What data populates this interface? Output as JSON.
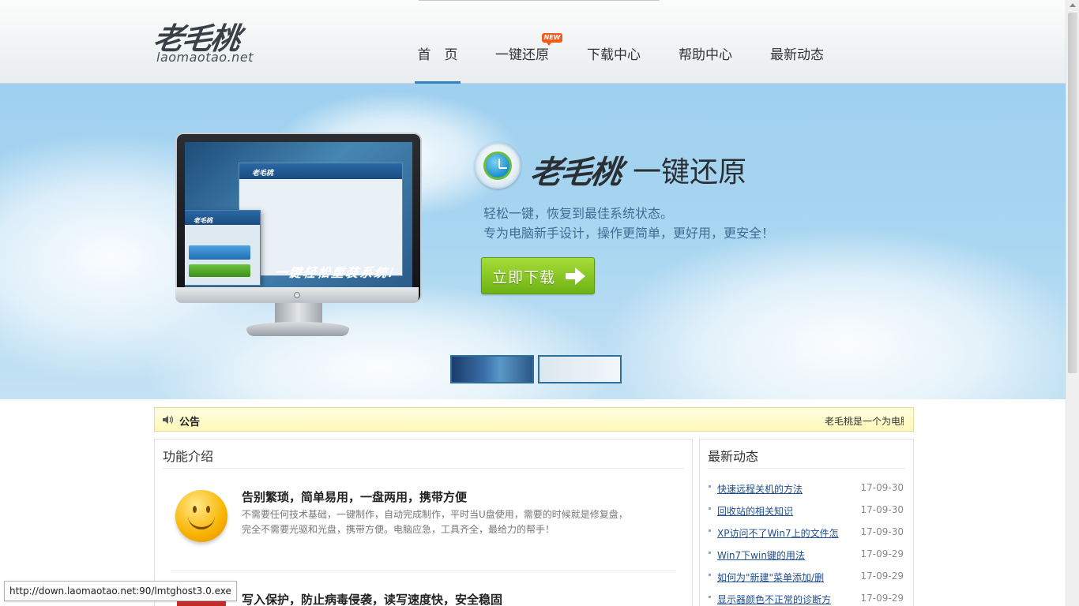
{
  "header": {
    "logo_cn": "老毛桃",
    "logo_en": "laomaotao.net",
    "nav": [
      {
        "label": "首　页"
      },
      {
        "label": "一键还原"
      },
      {
        "label": "下载中心"
      },
      {
        "label": "帮助中心"
      },
      {
        "label": "最新动态"
      }
    ],
    "new_badge": "NEW"
  },
  "banner": {
    "brand_logo": "老毛桃",
    "brand_sub": "一键还原",
    "tagline_1": "轻松一键，恢复到最佳系统状态。",
    "tagline_2": "专为电脑新手设计，操作更简单，更好用，更安全！",
    "download_label": "立即下载",
    "screen_slogan": "一键轻松重装系统!",
    "screen_logo": "老毛桃"
  },
  "notice": {
    "title": "公告",
    "text": "老毛桃是一个为电脑"
  },
  "features": {
    "title": "功能介绍",
    "items": [
      {
        "title": "告别繁琐，简单易用，一盘两用，携带方便",
        "desc": "不需要任何技术基础，一键制作，自动完成制作，平时当U盘使用，需要的时候就是修复盘，完全不需要光驱和光盘，携带方便。电脑应急，工具齐全，最给力的帮手！"
      },
      {
        "title": "写入保护，防止病毒侵袭，读写速度快，安全稳固",
        "desc": ""
      }
    ]
  },
  "news": {
    "title": "最新动态",
    "items": [
      {
        "title": "快速远程关机的方法",
        "date": "17-09-30"
      },
      {
        "title": "回收站的相关知识",
        "date": "17-09-30"
      },
      {
        "title": "XP访问不了Win7上的文件怎",
        "date": "17-09-30"
      },
      {
        "title": "Win7下win键的用法",
        "date": "17-09-29"
      },
      {
        "title": "如何为\"新建\"菜单添加/删",
        "date": "17-09-29"
      },
      {
        "title": "显示器颜色不正常的诊断方",
        "date": "17-09-29"
      }
    ]
  },
  "statusbar": {
    "url": "http://down.laomaotao.net:90/lmtghost3.0.exe"
  },
  "colors": {
    "accent": "#3a7fc1",
    "download_green": "#7cc21a",
    "notice_bg": "#fffbc9",
    "link": "#1f4d8a"
  }
}
